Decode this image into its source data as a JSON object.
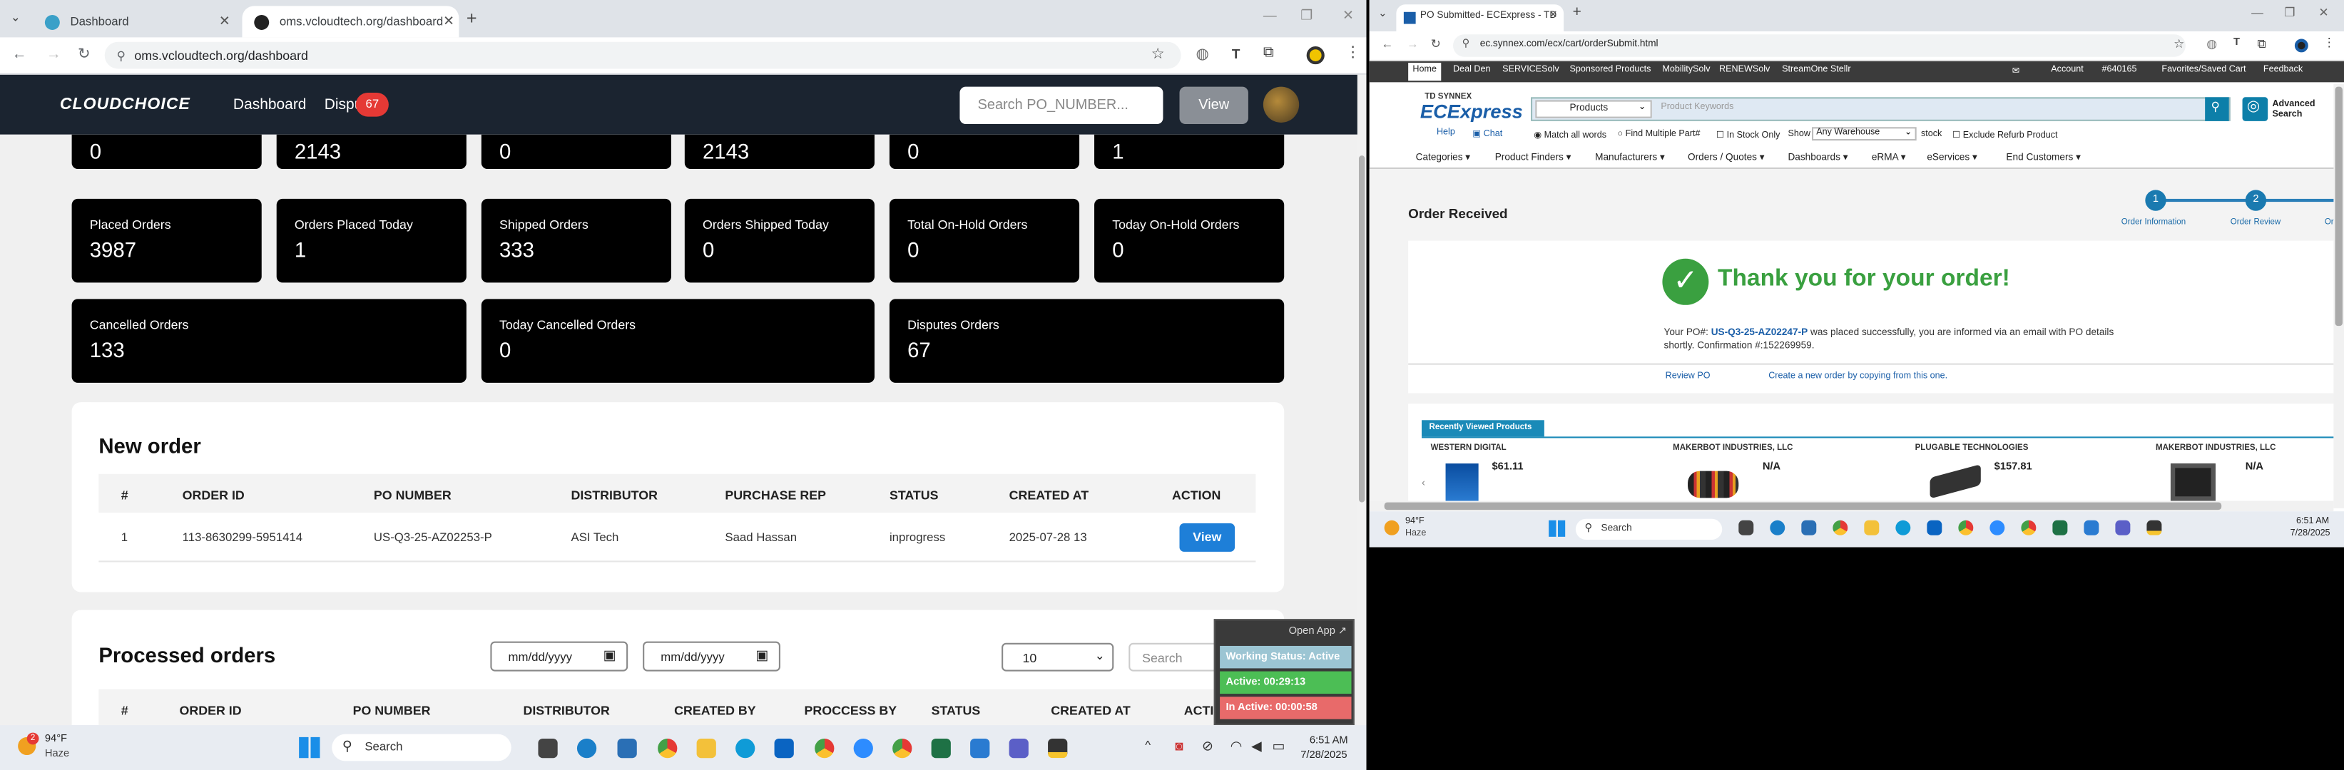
{
  "left_browser": {
    "tabs": [
      {
        "title": "Dashboard",
        "active": false
      },
      {
        "title": "oms.vcloudtech.org/dashboard",
        "active": true
      }
    ],
    "url": "oms.vcloudtech.org/dashboard"
  },
  "app": {
    "logo": "CLOUDCHOICE",
    "nav": {
      "dashboard": "Dashboard",
      "disputes": "Dispu",
      "disputes_badge": "67"
    },
    "search_placeholder": "Search PO_NUMBER...",
    "search_button": "View"
  },
  "stats_partial": [
    "0",
    "2143",
    "0",
    "2143",
    "0",
    "1"
  ],
  "stats_row2": [
    {
      "label": "Placed Orders",
      "value": "3987"
    },
    {
      "label": "Orders Placed Today",
      "value": "1"
    },
    {
      "label": "Shipped Orders",
      "value": "333"
    },
    {
      "label": "Orders Shipped Today",
      "value": "0"
    },
    {
      "label": "Total On-Hold Orders",
      "value": "0"
    },
    {
      "label": "Today On-Hold Orders",
      "value": "0"
    }
  ],
  "stats_row3": [
    {
      "label": "Cancelled Orders",
      "value": "133"
    },
    {
      "label": "Today Cancelled Orders",
      "value": "0"
    },
    {
      "label": "Disputes Orders",
      "value": "67"
    }
  ],
  "new_order": {
    "title": "New order",
    "headers": [
      "#",
      "ORDER ID",
      "PO NUMBER",
      "DISTRIBUTOR",
      "PURCHASE REP",
      "STATUS",
      "CREATED AT",
      "ACTION"
    ],
    "rows": [
      {
        "num": "1",
        "order_id": "113-8630299-5951414",
        "po": "US-Q3-25-AZ02253-P",
        "distributor": "ASI Tech",
        "rep": "Saad Hassan",
        "status": "inprogress",
        "created": "2025-07-28 13",
        "action": "View"
      }
    ]
  },
  "processed_orders": {
    "title": "Processed orders",
    "date_placeholder_1": "mm/dd/yyyy",
    "date_placeholder_2": "mm/dd/yyyy",
    "page_size": "10",
    "search_placeholder": "Search",
    "headers": [
      "#",
      "ORDER ID",
      "PO NUMBER",
      "DISTRIBUTOR",
      "CREATED BY",
      "PROCCESS BY",
      "STATUS",
      "CREATED AT",
      "ACTION"
    ]
  },
  "tracker": {
    "open_app": "Open App ↗",
    "working_status": "Working Status: Active",
    "active": "Active: 00:29:13",
    "inactive": "In Active: 00:00:58"
  },
  "left_taskbar": {
    "weather_temp": "94°F",
    "weather_desc": "Haze",
    "weather_badge": "2",
    "search": "Search",
    "time": "6:51 AM",
    "date": "7/28/2025"
  },
  "right_browser": {
    "tab_title": "PO Submitted- ECExpress - TD",
    "url": "ec.synnex.com/ecx/cart/orderSubmit.html",
    "topbar_links": [
      "Home",
      "Deal Den",
      "SERVICESolv",
      "Sponsored Products",
      "MobilitySolv",
      "RENEWSolv",
      "StreamOne Stellr"
    ],
    "topbar_right": [
      "Account",
      "#640165",
      "Favorites/Saved Cart",
      "Feedback"
    ],
    "brand_small": "TD SYNNEX",
    "brand": "ECExpress",
    "search_category": "Products",
    "search_placeholder": "Product Keywords",
    "advanced_search": "Advanced Search",
    "help": "Help",
    "chat": "Chat",
    "options": [
      "Match all words",
      "Find Multiple Part#",
      "In Stock Only"
    ],
    "show_label": "Show",
    "warehouse": "Any Warehouse",
    "stock": "stock",
    "exclude": "Exclude Refurb Product",
    "menu": [
      "Categories",
      "Product Finders",
      "Manufacturers",
      "Orders / Quotes",
      "Dashboards",
      "eRMA",
      "eServices",
      "End Customers"
    ],
    "order_received": "Order Received",
    "steps": [
      {
        "num": "1",
        "label": "Order Information"
      },
      {
        "num": "2",
        "label": "Order Review"
      },
      {
        "num": "",
        "label": "Or"
      }
    ],
    "thank_you": "Thank you for your order!",
    "po_prefix": "Your PO#:",
    "po_number": "US-Q3-25-AZ02247-P",
    "po_text": "was placed successfully, you are informed via an email with PO details shortly. Confirmation #:152269959.",
    "review_po": "Review PO",
    "create_new": "Create a new order by copying from this one.",
    "recently_viewed": "Recently Viewed Products",
    "products": [
      {
        "brand": "WESTERN DIGITAL",
        "price": "$61.11"
      },
      {
        "brand": "MAKERBOT INDUSTRIES, LLC",
        "price": "N/A"
      },
      {
        "brand": "PLUGABLE TECHNOLOGIES",
        "price": "$157.81"
      },
      {
        "brand": "MAKERBOT INDUSTRIES, LLC",
        "price": "N/A"
      }
    ]
  },
  "right_taskbar": {
    "weather_temp": "94°F",
    "weather_desc": "Haze",
    "search": "Search",
    "time": "6:51 AM",
    "date": "7/28/2025"
  }
}
